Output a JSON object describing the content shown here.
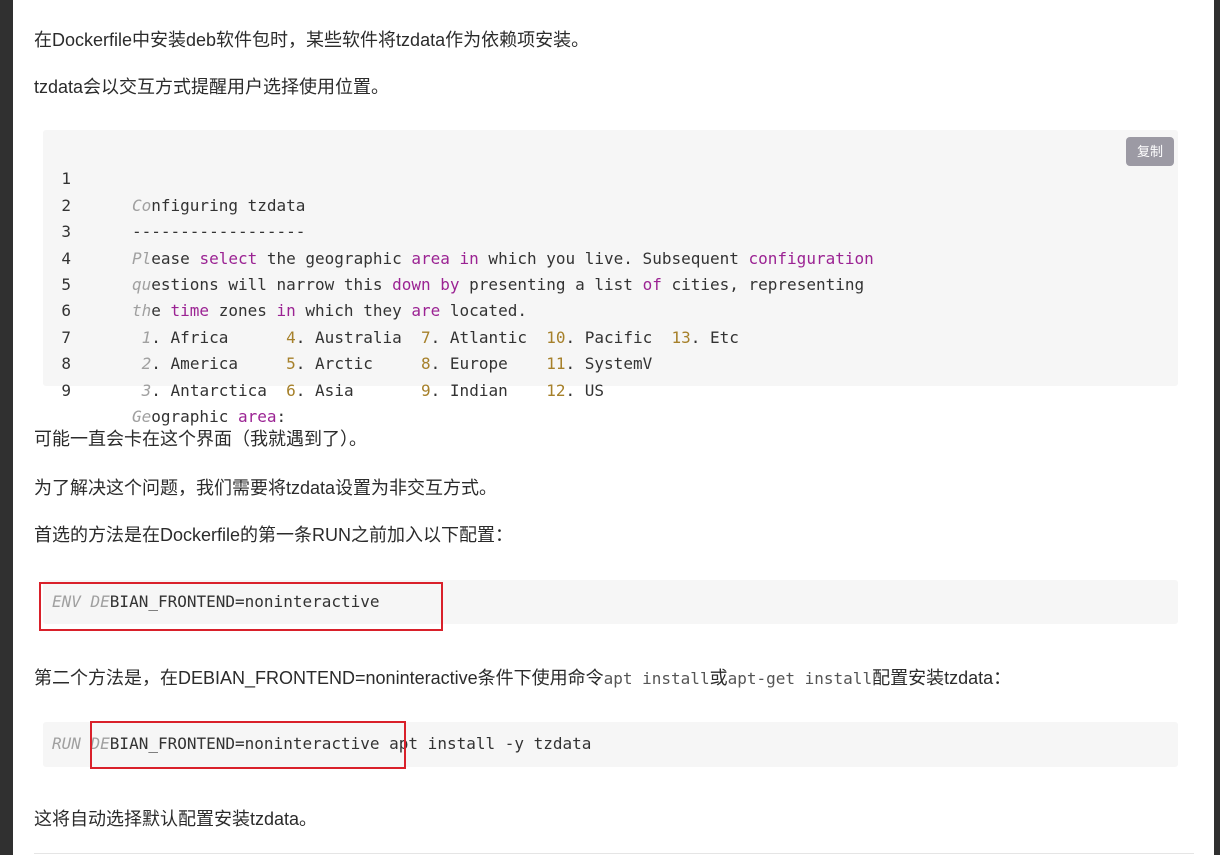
{
  "paragraphs": {
    "p1": "在Dockerfile中安装deb软件包时，某些软件将tzdata作为依赖项安装。",
    "p2": "tzdata会以交互方式提醒用户选择使用位置。",
    "p3": "可能一直会卡在这个界面（我就遇到了）。",
    "p4": "为了解决这个问题，我们需要将tzdata设置为非交互方式。",
    "p5": "首选的方法是在Dockerfile的第一条RUN之前加入以下配置：",
    "p6_before": "第二个方法是，在DEBIAN_FRONTEND=noninteractive条件下使用命令",
    "p6_code1": "apt install",
    "p6_or": "或",
    "p6_code2": "apt-get install",
    "p6_after": "配置安装tzdata：",
    "p7": "这将自动选择默认配置安装tzdata。"
  },
  "copy_button": "复制",
  "code_block_1": {
    "line_numbers": [
      "1",
      "2",
      "3",
      "4",
      "5",
      "6",
      "7",
      "8",
      "9"
    ],
    "l1": {
      "a": "Co",
      "b": "nfiguring tzdata"
    },
    "l2": {
      "a": "------------------"
    },
    "l3": {
      "a": "Pl",
      "b": "ease ",
      "c": "select",
      "d": " the geographic ",
      "e": "area",
      "f": " ",
      "g": "in",
      "h": " which you live. Subsequent ",
      "i": "configuration"
    },
    "l4": {
      "a": "qu",
      "b": "estions will narrow this ",
      "c": "down",
      "d": " ",
      "e": "by",
      "f": " presenting a list ",
      "g": "of",
      "h": " cities, representing"
    },
    "l5": {
      "a": "th",
      "b": "e ",
      "c": "time",
      "d": " zones ",
      "e": "in",
      "f": " which they ",
      "g": "are",
      "h": " located."
    },
    "l6": {
      "n1": "1",
      "t1": ". Africa      ",
      "n2": "4",
      "t2": ". Australia  ",
      "n3": "7",
      "t3": ". Atlantic  ",
      "n4": "10",
      "t4": ". Pacific  ",
      "n5": "13",
      "t5": ". Etc"
    },
    "l7": {
      "n1": "2",
      "t1": ". America     ",
      "n2": "5",
      "t2": ". Arctic     ",
      "n3": "8",
      "t3": ". Europe    ",
      "n4": "11",
      "t4": ". SystemV"
    },
    "l8": {
      "n1": "3",
      "t1": ". Antarctica  ",
      "n2": "6",
      "t2": ". Asia       ",
      "n3": "9",
      "t3": ". Indian    ",
      "n4": "12",
      "t4": ". US"
    },
    "l9": {
      "a": "Ge",
      "b": "ographic ",
      "c": "area",
      "d": ":"
    }
  },
  "code_block_2": {
    "a": "ENV DE",
    "b": "BIAN_FRONTEND=noninteractive"
  },
  "code_block_3": {
    "a": "RUN DE",
    "b": "BIAN_FRONTEND=noninteractive",
    "c": " apt install -y tzdata"
  },
  "colors": {
    "keyword": "#9b2393",
    "number": "#a6802a",
    "comment": "#a0a0a0",
    "highlight_box": "#d9202a"
  }
}
